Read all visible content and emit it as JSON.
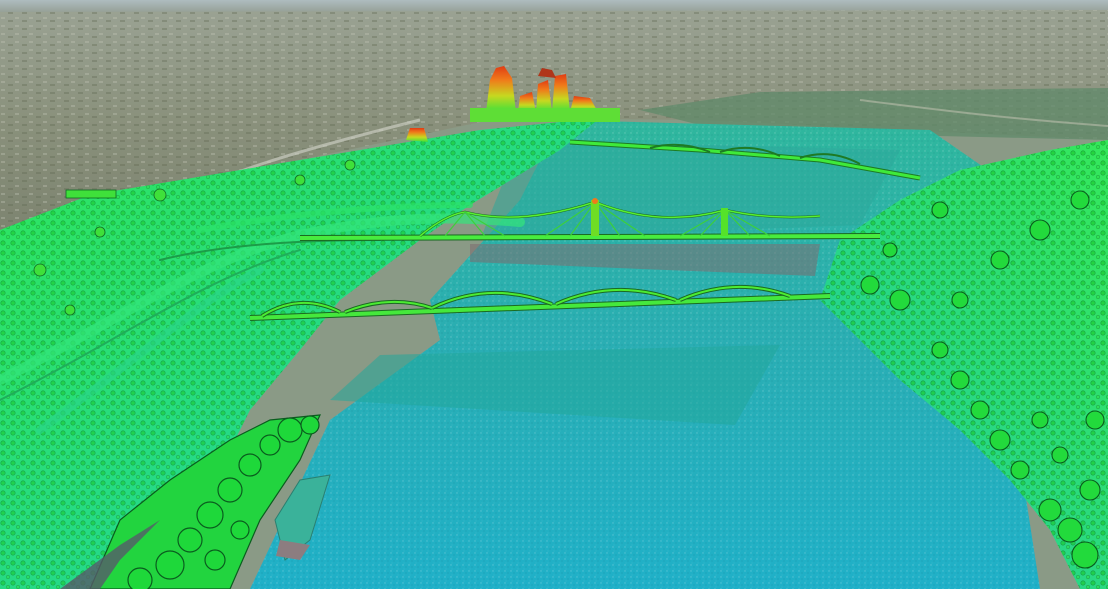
{
  "scene": {
    "kind": "3d-lidar-point-cloud-over-aerial-imagery",
    "colormap": "elevation",
    "colors": {
      "low_water": "#1fb3c2",
      "mid_ground": "#2fe07a",
      "vegetation": "#22dd33",
      "high": "#f05a1a",
      "terrain_far": "#8c957f",
      "sky_haze": "#b9c4c6"
    },
    "elements": [
      "downtown-skyline",
      "river",
      "far-bridge",
      "cable-stayed-bridge",
      "arch-bridge",
      "riverbank-trees",
      "highway-interchange"
    ]
  }
}
